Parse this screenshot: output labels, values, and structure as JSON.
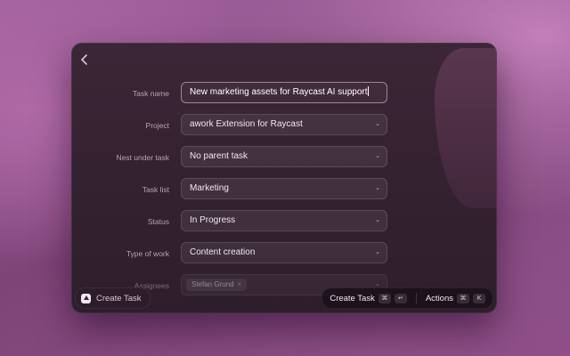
{
  "form": {
    "fields": [
      {
        "label": "Task name",
        "value": "New marketing assets for Raycast AI support"
      },
      {
        "label": "Project",
        "value": "awork Extension for Raycast"
      },
      {
        "label": "Nest under task",
        "value": "No parent task"
      },
      {
        "label": "Task list",
        "value": "Marketing"
      },
      {
        "label": "Status",
        "value": "In Progress"
      },
      {
        "label": "Type of work",
        "value": "Content creation"
      }
    ],
    "assignees": {
      "label": "Assignees",
      "chips": [
        "Stefan Grund"
      ],
      "chip_remove": "×"
    }
  },
  "footer": {
    "command_title": "Create Task",
    "primary_action": "Create Task",
    "primary_shortcut": [
      "⌘",
      "↵"
    ],
    "actions_label": "Actions",
    "actions_shortcut": [
      "⌘",
      "K"
    ]
  },
  "icons": {
    "back": "chevron-left-icon",
    "dropdown": "chevron-down-icon",
    "extension": "awork-logo-icon"
  },
  "colors": {
    "window_bg": "#33212f",
    "desktop_bg": "#8c5288",
    "text_primary": "#f1e8ef",
    "label": "#b8a3b3"
  }
}
